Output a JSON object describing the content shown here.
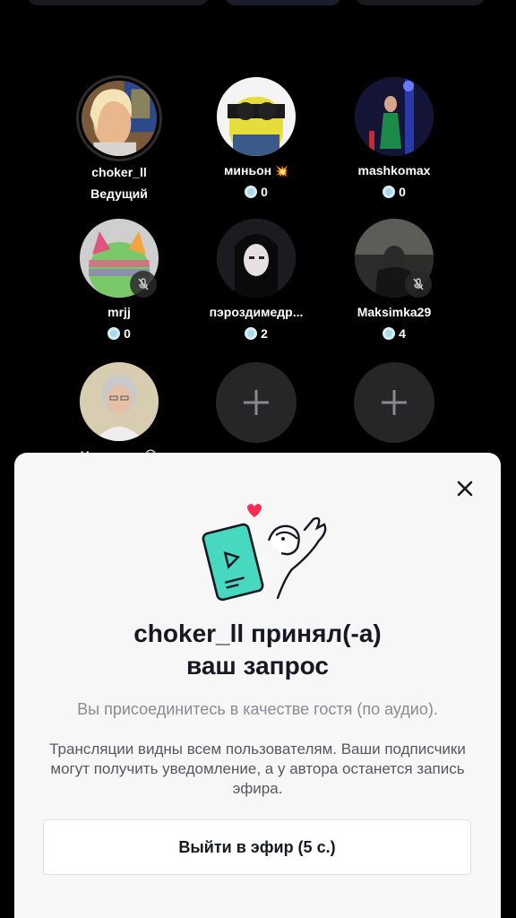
{
  "guests": [
    {
      "name": "choker_ll",
      "role": "Ведущий",
      "host": true,
      "muted": false
    },
    {
      "name": "миньон",
      "emoji": "💥",
      "coins": "0",
      "muted": false
    },
    {
      "name": "mashkomax",
      "coins": "0",
      "muted": false
    },
    {
      "name": "mrjj",
      "coins": "0",
      "muted": true
    },
    {
      "name": "пэроздимедр...",
      "coins": "2",
      "muted": false
    },
    {
      "name": "Maksimka29",
      "coins": "4",
      "muted": true
    },
    {
      "name": "Неуннуна",
      "emoji": "😭",
      "muted": false
    }
  ],
  "sheet": {
    "title_line1": "choker_ll принял(-а)",
    "title_line2": "ваш запрос",
    "subtitle": "Вы присоединитесь в качестве гостя (по аудио).",
    "description": "Трансляции видны всем пользователям. Ваши подписчики могут получить уведомление, а у автора останется запись эфира.",
    "button_label": "Выйти в эфир (5 с.)"
  },
  "icons": {
    "close": "close-icon",
    "mute": "microphone-muted-icon",
    "add": "plus-icon",
    "coin": "coin-icon"
  },
  "colors": {
    "accent_teal": "#46d9c0",
    "heart": "#fe2c55",
    "coin": "#a9d9ec"
  }
}
